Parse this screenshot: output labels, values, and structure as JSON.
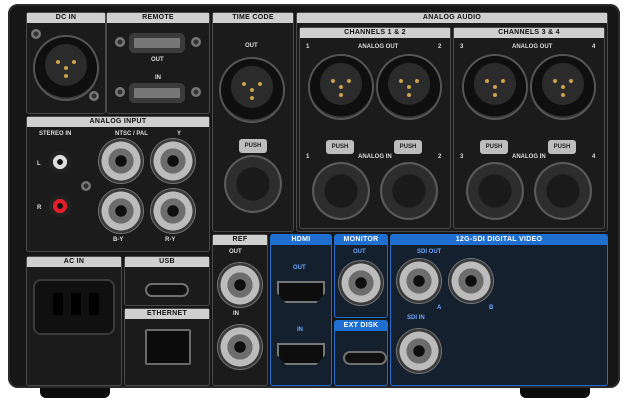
{
  "sections": {
    "dc_in": "DC IN",
    "remote": "REMOTE",
    "remote_out": "OUT",
    "remote_in": "IN",
    "time_code": "TIME CODE",
    "time_code_out": "OUT",
    "analog_audio": "ANALOG AUDIO",
    "channels_12": "CHANNELS 1 & 2",
    "channels_34": "CHANNELS 3 & 4",
    "analog_out": "ANALOG OUT",
    "analog_in": "ANALOG IN",
    "analog_input": "ANALOG INPUT",
    "stereo_in": "STEREO IN",
    "ntsc_pal": "NTSC / PAL",
    "y": "Y",
    "b_y": "B-Y",
    "r_y": "R-Y",
    "L": "L",
    "R": "R",
    "ref": "REF",
    "ref_out": "OUT",
    "ref_in": "IN",
    "hdmi": "HDMI",
    "hdmi_out": "OUT",
    "hdmi_in": "IN",
    "monitor": "MONITOR",
    "monitor_out": "OUT",
    "ext_disk": "EXT DISK",
    "sdi_title": "12G-SDI DIGITAL VIDEO",
    "sdi_out": "SDI OUT",
    "sdi_in": "SDI IN",
    "sdi_a": "A",
    "sdi_b": "B",
    "ac_in": "AC IN",
    "usb": "USB",
    "ethernet": "ETHERNET",
    "push": "PUSH",
    "ch1": "1",
    "ch2": "2",
    "ch3": "3",
    "ch4": "4"
  }
}
